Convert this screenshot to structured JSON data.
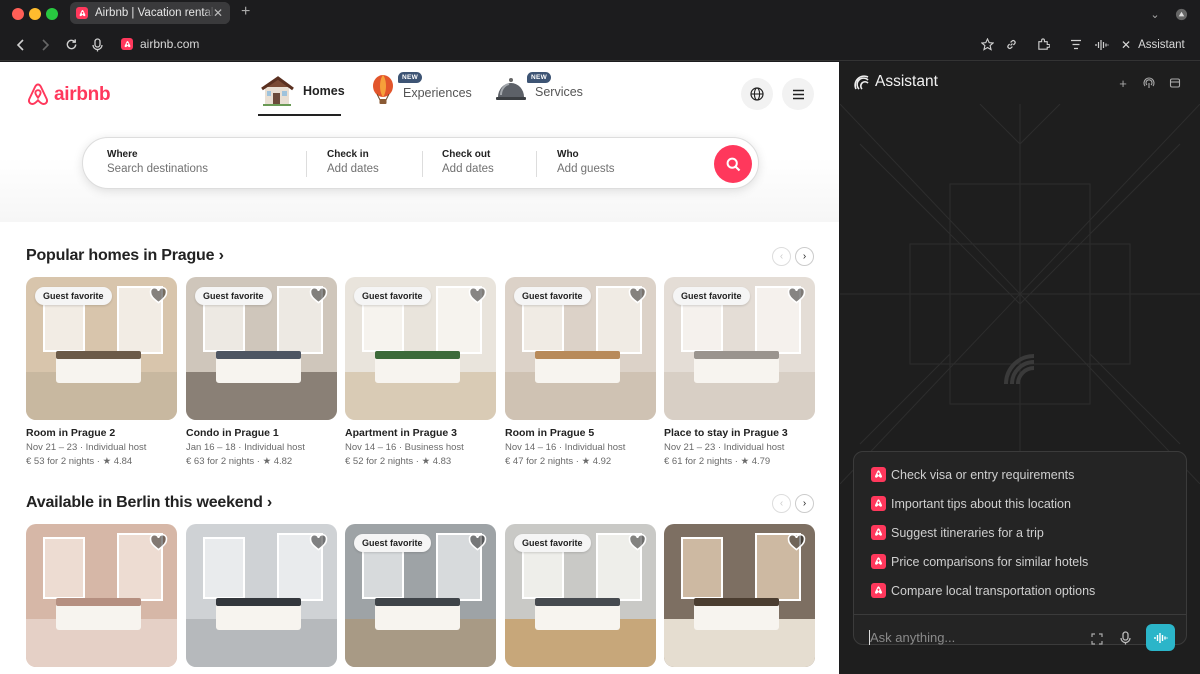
{
  "browser": {
    "tab_title": "Airbnb | Vacation rentals, ca",
    "tab_close": "✕",
    "new_tab": "+",
    "url": "airbnb.com",
    "assistant_button": "Assistant"
  },
  "header": {
    "logo_text": "airbnb",
    "nav": [
      {
        "label": "Homes",
        "active": true
      },
      {
        "label": "Experiences",
        "badge": "NEW"
      },
      {
        "label": "Services",
        "badge": "NEW"
      }
    ]
  },
  "search": {
    "where_label": "Where",
    "where_placeholder": "Search destinations",
    "checkin_label": "Check in",
    "checkin_placeholder": "Add dates",
    "checkout_label": "Check out",
    "checkout_placeholder": "Add dates",
    "who_label": "Who",
    "who_placeholder": "Add guests"
  },
  "sections": [
    {
      "title": "Popular homes in Prague ›",
      "cards": [
        {
          "badge": "Guest favorite",
          "title": "Room in Prague 2",
          "dates": "Nov 21 – 23 · Individual host",
          "price": "€ 53 for 2 nights · ★ 4.84"
        },
        {
          "badge": "Guest favorite",
          "title": "Condo in Prague 1",
          "dates": "Jan 16 – 18 · Individual host",
          "price": "€ 63 for 2 nights · ★ 4.82"
        },
        {
          "badge": "Guest favorite",
          "title": "Apartment in Prague 3",
          "dates": "Nov 14 – 16 · Business host",
          "price": "€ 52 for 2 nights · ★ 4.83"
        },
        {
          "badge": "Guest favorite",
          "title": "Room in Prague 5",
          "dates": "Nov 14 – 16 · Individual host",
          "price": "€ 47 for 2 nights · ★ 4.92"
        },
        {
          "badge": "Guest favorite",
          "title": "Place to stay in Prague 3",
          "dates": "Nov 21 – 23 · Individual host",
          "price": "€ 61 for 2 nights · ★ 4.79"
        }
      ]
    },
    {
      "title": "Available in Berlin this weekend ›",
      "cards": [
        {
          "badge": ""
        },
        {
          "badge": ""
        },
        {
          "badge": "Guest favorite"
        },
        {
          "badge": "Guest favorite"
        },
        {
          "badge": ""
        }
      ]
    }
  ],
  "assistant": {
    "title": "Assistant",
    "suggestions": [
      "Check visa or entry requirements",
      "Important tips about this location",
      "Suggest itineraries for a trip",
      "Price comparisons for similar hotels",
      "Compare local transportation options"
    ],
    "input_placeholder": "Ask anything..."
  },
  "colors": {
    "brand": "#FF385C",
    "voice_button": "#2BB5C9"
  }
}
